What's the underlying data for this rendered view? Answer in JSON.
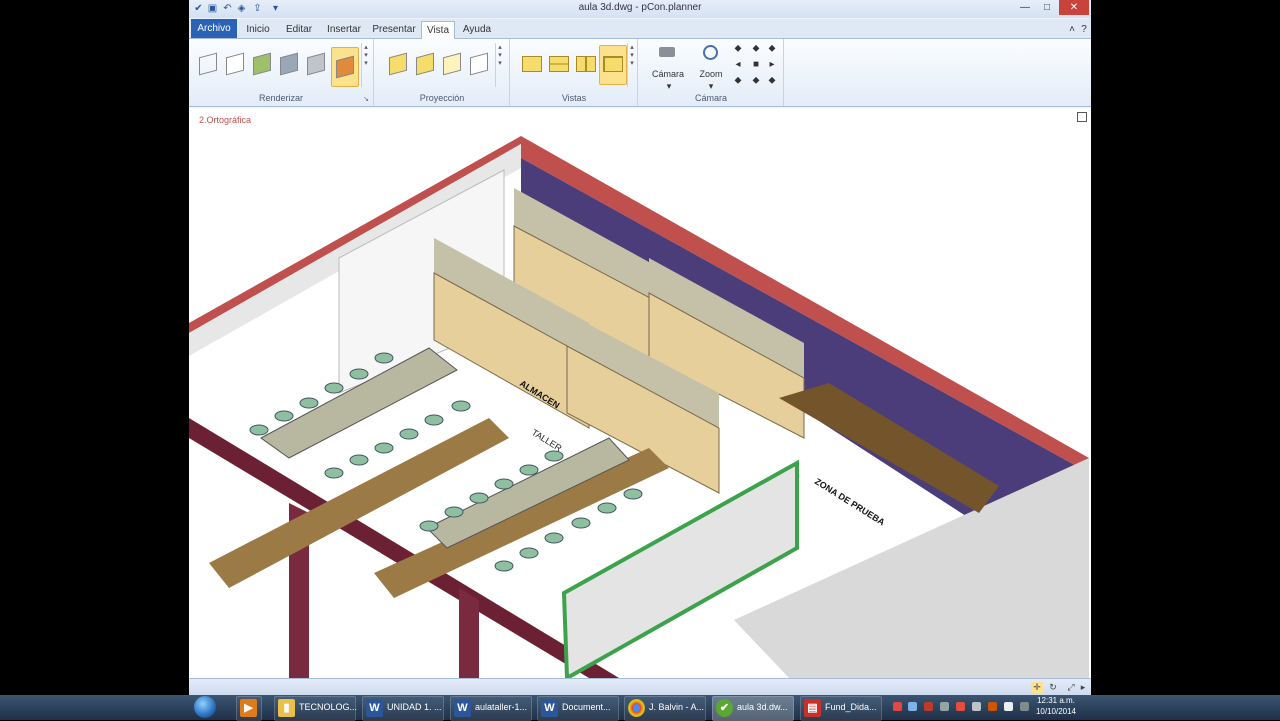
{
  "window": {
    "title": "aula 3d.dwg - pCon.planner",
    "minimize": "—",
    "maximize": "□",
    "close": "✕"
  },
  "menu": {
    "tabs": [
      "Archivo",
      "Inicio",
      "Editar",
      "Insertar",
      "Presentar",
      "Vista",
      "Ayuda"
    ],
    "active": "Vista"
  },
  "ribbon": {
    "groups": [
      {
        "label": "Renderizar"
      },
      {
        "label": "Proyección"
      },
      {
        "label": "Vistas"
      },
      {
        "label": "Cámara"
      }
    ],
    "camera_button": "Cámara",
    "zoom_button": "Zoom"
  },
  "viewport": {
    "label": "2.Ortográfica",
    "scene_labels": [
      "ALMACEN",
      "TALLER",
      "ZONA DE PRUEBA"
    ]
  },
  "taskbar": {
    "items": [
      {
        "icon": "folder-icon",
        "label": "TECNOLOG..."
      },
      {
        "icon": "word-icon",
        "label": "UNIDAD 1. ..."
      },
      {
        "icon": "word-icon",
        "label": "aulataller-1..."
      },
      {
        "icon": "word-icon",
        "label": "Document..."
      },
      {
        "icon": "chrome-icon",
        "label": "J. Balvin - A..."
      },
      {
        "icon": "pcon-icon",
        "label": "aula 3d.dw..."
      },
      {
        "icon": "pdf-icon",
        "label": "Fund_Dida..."
      }
    ],
    "clock_time": "12:31 a.m.",
    "clock_date": "10/10/2014"
  },
  "colors": {
    "accent": "#2a62b6",
    "wall_red": "#c0504d",
    "wall_purple": "#4a3b7a",
    "floor_wood": "#b8955b",
    "green_edge": "#3ca24b"
  }
}
